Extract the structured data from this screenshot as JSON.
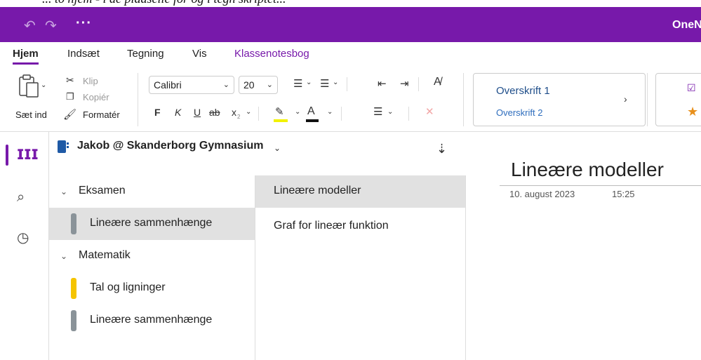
{
  "window": {
    "app_name": "OneN"
  },
  "top_strip_text": "... to hjem - i de pladselle for og i tegn skriptet...",
  "tabs": [
    {
      "label": "Hjem"
    },
    {
      "label": "Indsæt"
    },
    {
      "label": "Tegning"
    },
    {
      "label": "Vis"
    },
    {
      "label": "Klassenotesbog"
    }
  ],
  "clipboard": {
    "paste_label": "Sæt ind",
    "cut_label": "Klip",
    "copy_label": "Kopiér",
    "format_label": "Formatér"
  },
  "font": {
    "family": "Calibri",
    "size": "20"
  },
  "format_buttons": {
    "bold": "F",
    "italic": "K",
    "underline": "U",
    "strike": "ab",
    "subscript": "x"
  },
  "styles": {
    "heading1": "Overskrift 1",
    "heading2": "Overskrift 2"
  },
  "notebook": {
    "title": "Jakob @ Skanderborg Gymnasium"
  },
  "sections": [
    {
      "type": "group",
      "label": "Eksamen"
    },
    {
      "type": "section",
      "label": "Lineære sammenhænge",
      "color": "#8a9399",
      "selected": true
    },
    {
      "type": "group",
      "label": "Matematik"
    },
    {
      "type": "section",
      "label": "Tal og ligninger",
      "color": "#f5c400",
      "selected": false
    },
    {
      "type": "section",
      "label": "Lineære sammenhænge",
      "color": "#8a9399",
      "selected": false
    }
  ],
  "pages": [
    {
      "label": "Lineære modeller",
      "selected": true
    },
    {
      "label": "Graf for lineær funktion",
      "selected": false
    }
  ],
  "page": {
    "title": "Lineære modeller",
    "date": "10. august 2023",
    "time": "15:25"
  },
  "colors": {
    "accent": "#7719aa",
    "selection": "#e1e1e1"
  }
}
